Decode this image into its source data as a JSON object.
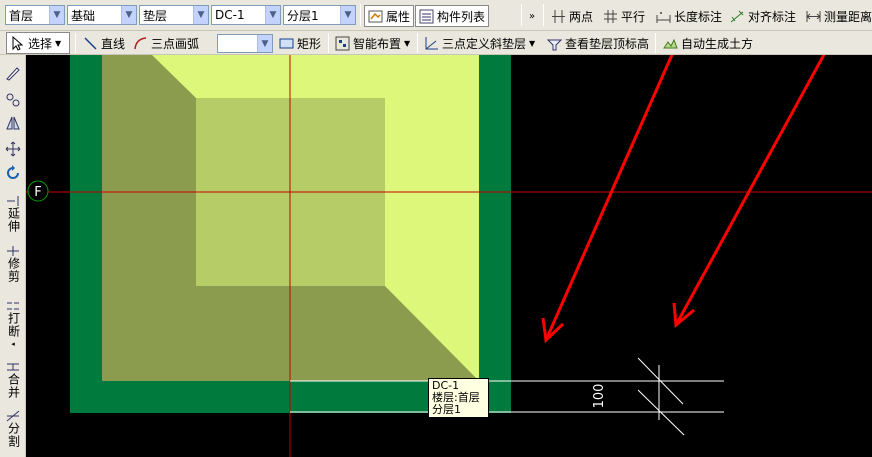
{
  "toolbar_top": {
    "floor": "首层",
    "category": "基础",
    "component_type": "垫层",
    "component": "DC-1",
    "layer": "分层1",
    "properties_label": "属性",
    "component_list_label": "构件列表",
    "two_points_label": "两点",
    "parallel_label": "平行",
    "length_dim_label": "长度标注",
    "aligned_dim_label": "对齐标注",
    "measure_label": "测量距离"
  },
  "toolbar_draw": {
    "select_label": "选择",
    "line_label": "直线",
    "arc_label": "三点画弧",
    "arc_combo_value": "",
    "rect_label": "矩形",
    "smart_label": "智能布置",
    "slope_label": "三点定义斜垫层",
    "view_top_label": "查看垫层顶标高",
    "auto_earth_label": "自动生成土方"
  },
  "left_toolbar": {
    "extend_label": "延伸",
    "trim_label": "修剪",
    "break_label": "打断",
    "merge_label": "合并",
    "split_label": "分割"
  },
  "canvas": {
    "axis_label": "F",
    "dimension_value": "100",
    "tooltip_line1": "DC-1",
    "tooltip_line2": "楼层:首层",
    "tooltip_line3": "分层1",
    "colors": {
      "footing_outer": "#007a3d",
      "footing_inner": "#dcf77a",
      "footing_shadow": "#8b9c4e",
      "footing_top": "#b5cc67",
      "crosshair": "#c80000",
      "annotation_arrow": "#ff0000"
    }
  }
}
